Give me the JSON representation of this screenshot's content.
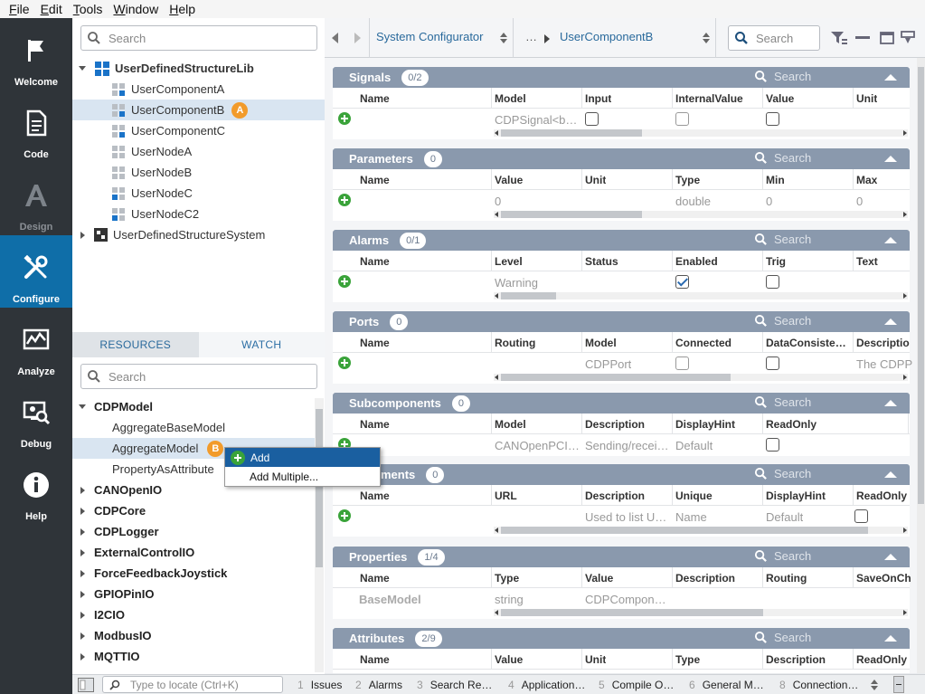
{
  "menu": [
    "File",
    "Edit",
    "Tools",
    "Window",
    "Help"
  ],
  "menu_mnemonics": [
    "F",
    "E",
    "T",
    "W",
    "H"
  ],
  "menu_rest": [
    "ile",
    "dit",
    "ools",
    "indow",
    "elp"
  ],
  "nav": [
    {
      "label": "Welcome",
      "icon": "flag-icon"
    },
    {
      "label": "Code",
      "icon": "document-icon"
    },
    {
      "label": "Design",
      "icon": "design-icon"
    },
    {
      "label": "Configure",
      "icon": "tools-icon"
    },
    {
      "label": "Analyze",
      "icon": "chart-icon"
    },
    {
      "label": "Debug",
      "icon": "debug-icon"
    },
    {
      "label": "Help",
      "icon": "info-icon"
    }
  ],
  "tree": {
    "search_placeholder": "Search",
    "root": "UserDefinedStructureLib",
    "items": [
      "UserComponentA",
      "UserComponentB",
      "UserComponentC",
      "UserNodeA",
      "UserNodeB",
      "UserNodeC",
      "UserNodeC2"
    ],
    "selected_badge": "A",
    "system": "UserDefinedStructureSystem"
  },
  "tabs": [
    "RESOURCES",
    "WATCH"
  ],
  "resources": {
    "search_placeholder": "Search",
    "group": "CDPModel",
    "children": [
      "AggregateBaseModel",
      "AggregateModel",
      "PropertyAsAttribute"
    ],
    "selected_badge": "B",
    "collapsed": [
      "CANOpenIO",
      "CDPCore",
      "CDPLogger",
      "ExternalControlIO",
      "ForceFeedbackJoystick",
      "GPIOPinIO",
      "I2CIO",
      "ModbusIO",
      "MQTTIO"
    ]
  },
  "context_menu": [
    "Add",
    "Add Multiple..."
  ],
  "toolbar": {
    "configurator": "System Configurator",
    "crumb_ellipsis": "…",
    "crumb_current": "UserComponentB",
    "search_placeholder": "Search"
  },
  "sections": {
    "signals": {
      "title": "Signals",
      "count": "0/2",
      "search": "Search",
      "cols": [
        "Name",
        "Model",
        "Input",
        "InternalValue",
        "Value",
        "Unit"
      ],
      "row": {
        "model": "CDPSignal<b…"
      }
    },
    "parameters": {
      "title": "Parameters",
      "count": "0",
      "search": "Search",
      "cols": [
        "Name",
        "Value",
        "Unit",
        "Type",
        "Min",
        "Max"
      ],
      "row": {
        "value": "0",
        "type": "double",
        "min": "0",
        "max": "0"
      }
    },
    "alarms": {
      "title": "Alarms",
      "count": "0/1",
      "search": "Search",
      "cols": [
        "Name",
        "Level",
        "Status",
        "Enabled",
        "Trig",
        "Text"
      ],
      "row": {
        "level": "Warning"
      }
    },
    "ports": {
      "title": "Ports",
      "count": "0",
      "search": "Search",
      "cols": [
        "Name",
        "Routing",
        "Model",
        "Connected",
        "DataConsiste…",
        "Descriptio"
      ],
      "row": {
        "model": "CDPPort",
        "desc": "The CDPP"
      }
    },
    "subcomponents": {
      "title": "Subcomponents",
      "count": "0",
      "search": "Search",
      "cols": [
        "Name",
        "Model",
        "Description",
        "DisplayHint",
        "ReadOnly"
      ],
      "row": {
        "model": "CANOpenPCI…",
        "desc": "Sending/recei…",
        "hint": "Default"
      }
    },
    "documents": {
      "title": "ments",
      "count": "0",
      "search": "Search",
      "cols": [
        "Name",
        "URL",
        "Description",
        "Unique",
        "DisplayHint",
        "ReadOnly"
      ],
      "row": {
        "desc": "Used to list U…",
        "unique": "Name",
        "hint": "Default"
      }
    },
    "properties": {
      "title": "Properties",
      "count": "1/4",
      "search": "Search",
      "cols": [
        "Name",
        "Type",
        "Value",
        "Description",
        "Routing",
        "SaveOnCh"
      ],
      "row": {
        "name": "BaseModel",
        "type": "string",
        "value": "CDPCompon…"
      }
    },
    "attributes": {
      "title": "Attributes",
      "count": "2/9",
      "search": "Search",
      "cols": [
        "Name",
        "Value",
        "Unit",
        "Type",
        "Description",
        "ReadOnly"
      ]
    }
  },
  "status": {
    "locate_placeholder": "Type to locate (Ctrl+K)",
    "tabs": [
      {
        "n": "1",
        "label": "Issues"
      },
      {
        "n": "2",
        "label": "Alarms"
      },
      {
        "n": "3",
        "label": "Search Re…"
      },
      {
        "n": "4",
        "label": "Application…"
      },
      {
        "n": "5",
        "label": "Compile O…"
      },
      {
        "n": "6",
        "label": "General M…"
      },
      {
        "n": "8",
        "label": "Connection…"
      }
    ]
  },
  "colors": {
    "accent": "#0f6ea8",
    "badge": "#f29b2b",
    "section_header": "#8a99ad",
    "add_green": "#3aa33a"
  }
}
